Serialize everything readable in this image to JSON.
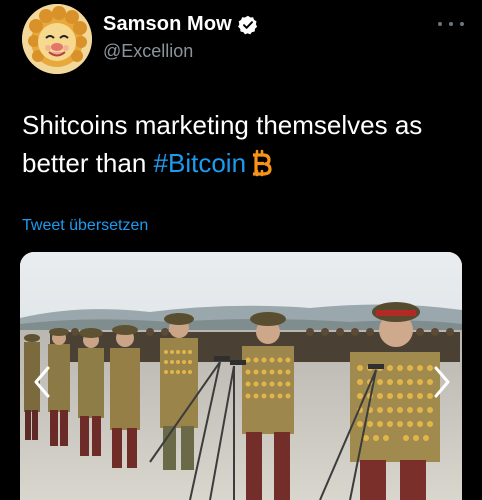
{
  "author": {
    "display_name": "Samson Mow",
    "handle": "@Excellion",
    "avatar_icon": "lion-avatar-icon",
    "verified_icon": "verified-badge-icon"
  },
  "tweet": {
    "text_before": "Shitcoins marketing themselves as better than ",
    "hashtag": "#Bitcoin",
    "emoji_icon": "bitcoin-icon",
    "translate_label": "Tweet übersetzen"
  },
  "media": {
    "subject": "photo of uniformed officers with medals standing at microphones",
    "prev_icon": "chevron-left-icon",
    "next_icon": "chevron-right-icon"
  },
  "menu": {
    "icon": "more-options-icon"
  },
  "colors": {
    "background": "#000000",
    "text": "#ffffff",
    "secondary_text": "#8b949b",
    "link": "#1d9bf0",
    "bitcoin": "#f7931a"
  }
}
